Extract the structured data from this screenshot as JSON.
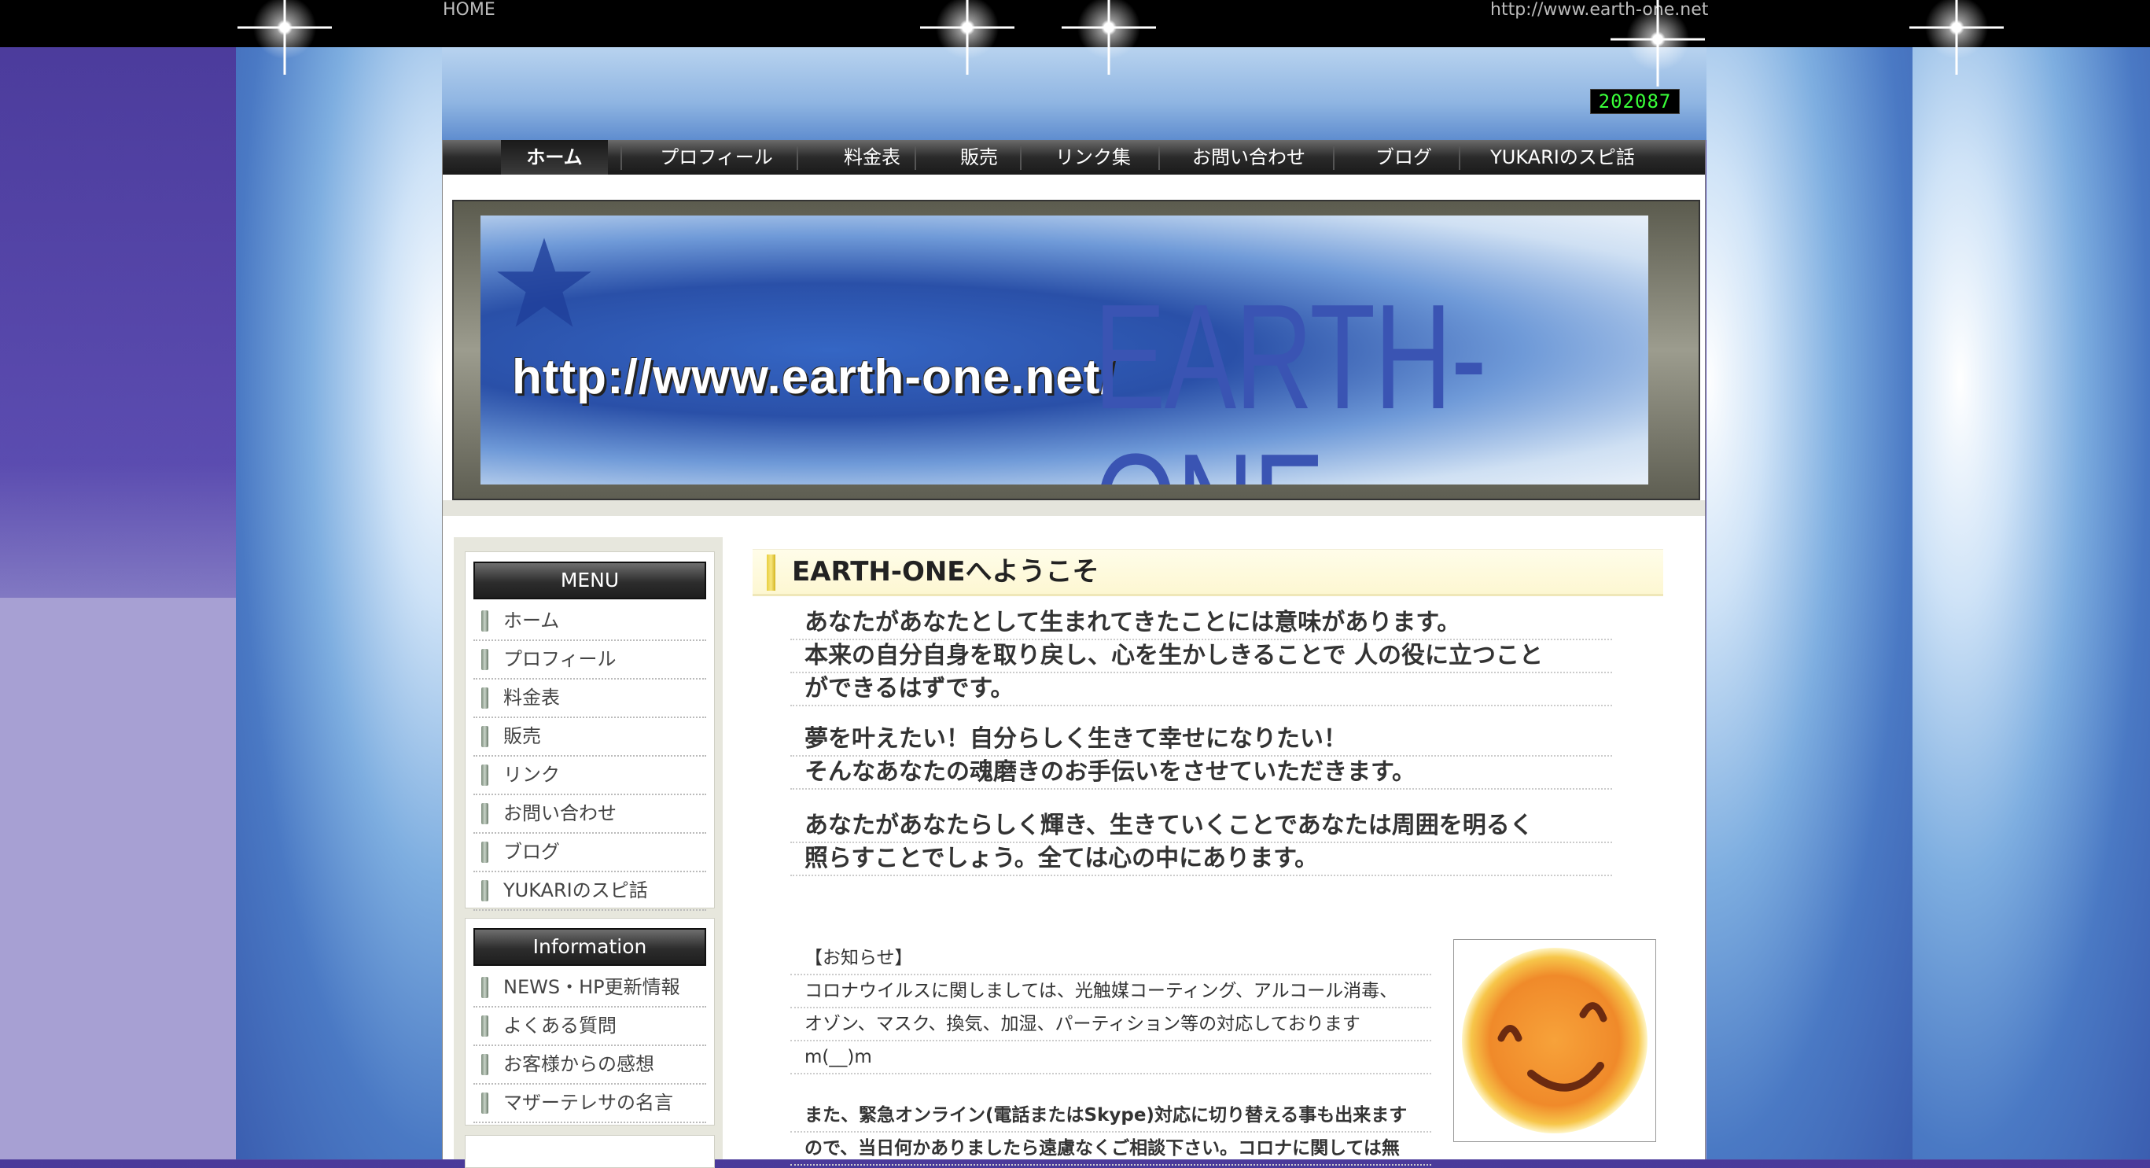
{
  "topbar": {
    "home": "HOME",
    "url": "http://www.earth-one.net"
  },
  "counter": "202087",
  "nav": {
    "items": [
      {
        "label": "ホーム"
      },
      {
        "label": "プロフィール"
      },
      {
        "label": "料金表"
      },
      {
        "label": "販売"
      },
      {
        "label": "リンク集"
      },
      {
        "label": "お問い合わせ"
      },
      {
        "label": "ブログ"
      },
      {
        "label": "YUKARIのスピ話"
      }
    ]
  },
  "banner": {
    "url_text": "http://www.earth-one.net/",
    "logo_text": "EARTH-ONE"
  },
  "sidebar": {
    "menu_title": "MENU",
    "menu_items": [
      "ホーム",
      "プロフィール",
      "料金表",
      "販売",
      "リンク",
      "お問い合わせ",
      "ブログ",
      "YUKARIのスピ話"
    ],
    "info_title": "Information",
    "info_items": [
      "NEWS・HP更新情報",
      "よくある質問",
      "お客様からの感想",
      "マザーテレサの名言"
    ]
  },
  "main": {
    "heading": "EARTH-ONEへようこそ",
    "p1": [
      "あなたがあなたとして生まれてきたことには意味があります。",
      "本来の自分自身を取り戻し、心を生かしきることで 人の役に立つこと",
      "ができるはずです。"
    ],
    "p2": [
      "夢を叶えたい！自分らしく生きて幸せになりたい！",
      "そんなあなたの魂磨きのお手伝いをさせていただきます。"
    ],
    "p3": [
      "あなたがあなたらしく輝き、生きていくことであなたは周囲を明るく",
      "照らすことでしょう。全ては心の中にあります。"
    ],
    "notice": [
      "【お知らせ】",
      "コロナウイルスに関しましては、光触媒コーティング、アルコール消毒、",
      "オゾン、マスク、換気、加湿、パーティション等の対応しております",
      "m(__)m"
    ],
    "notice2": [
      "また、緊急オンライン(電話またはSkype)対応に切り替える事も出来ます",
      "ので、当日何かありましたら遠慮なくご相談下さい。コロナに関しては無"
    ]
  }
}
